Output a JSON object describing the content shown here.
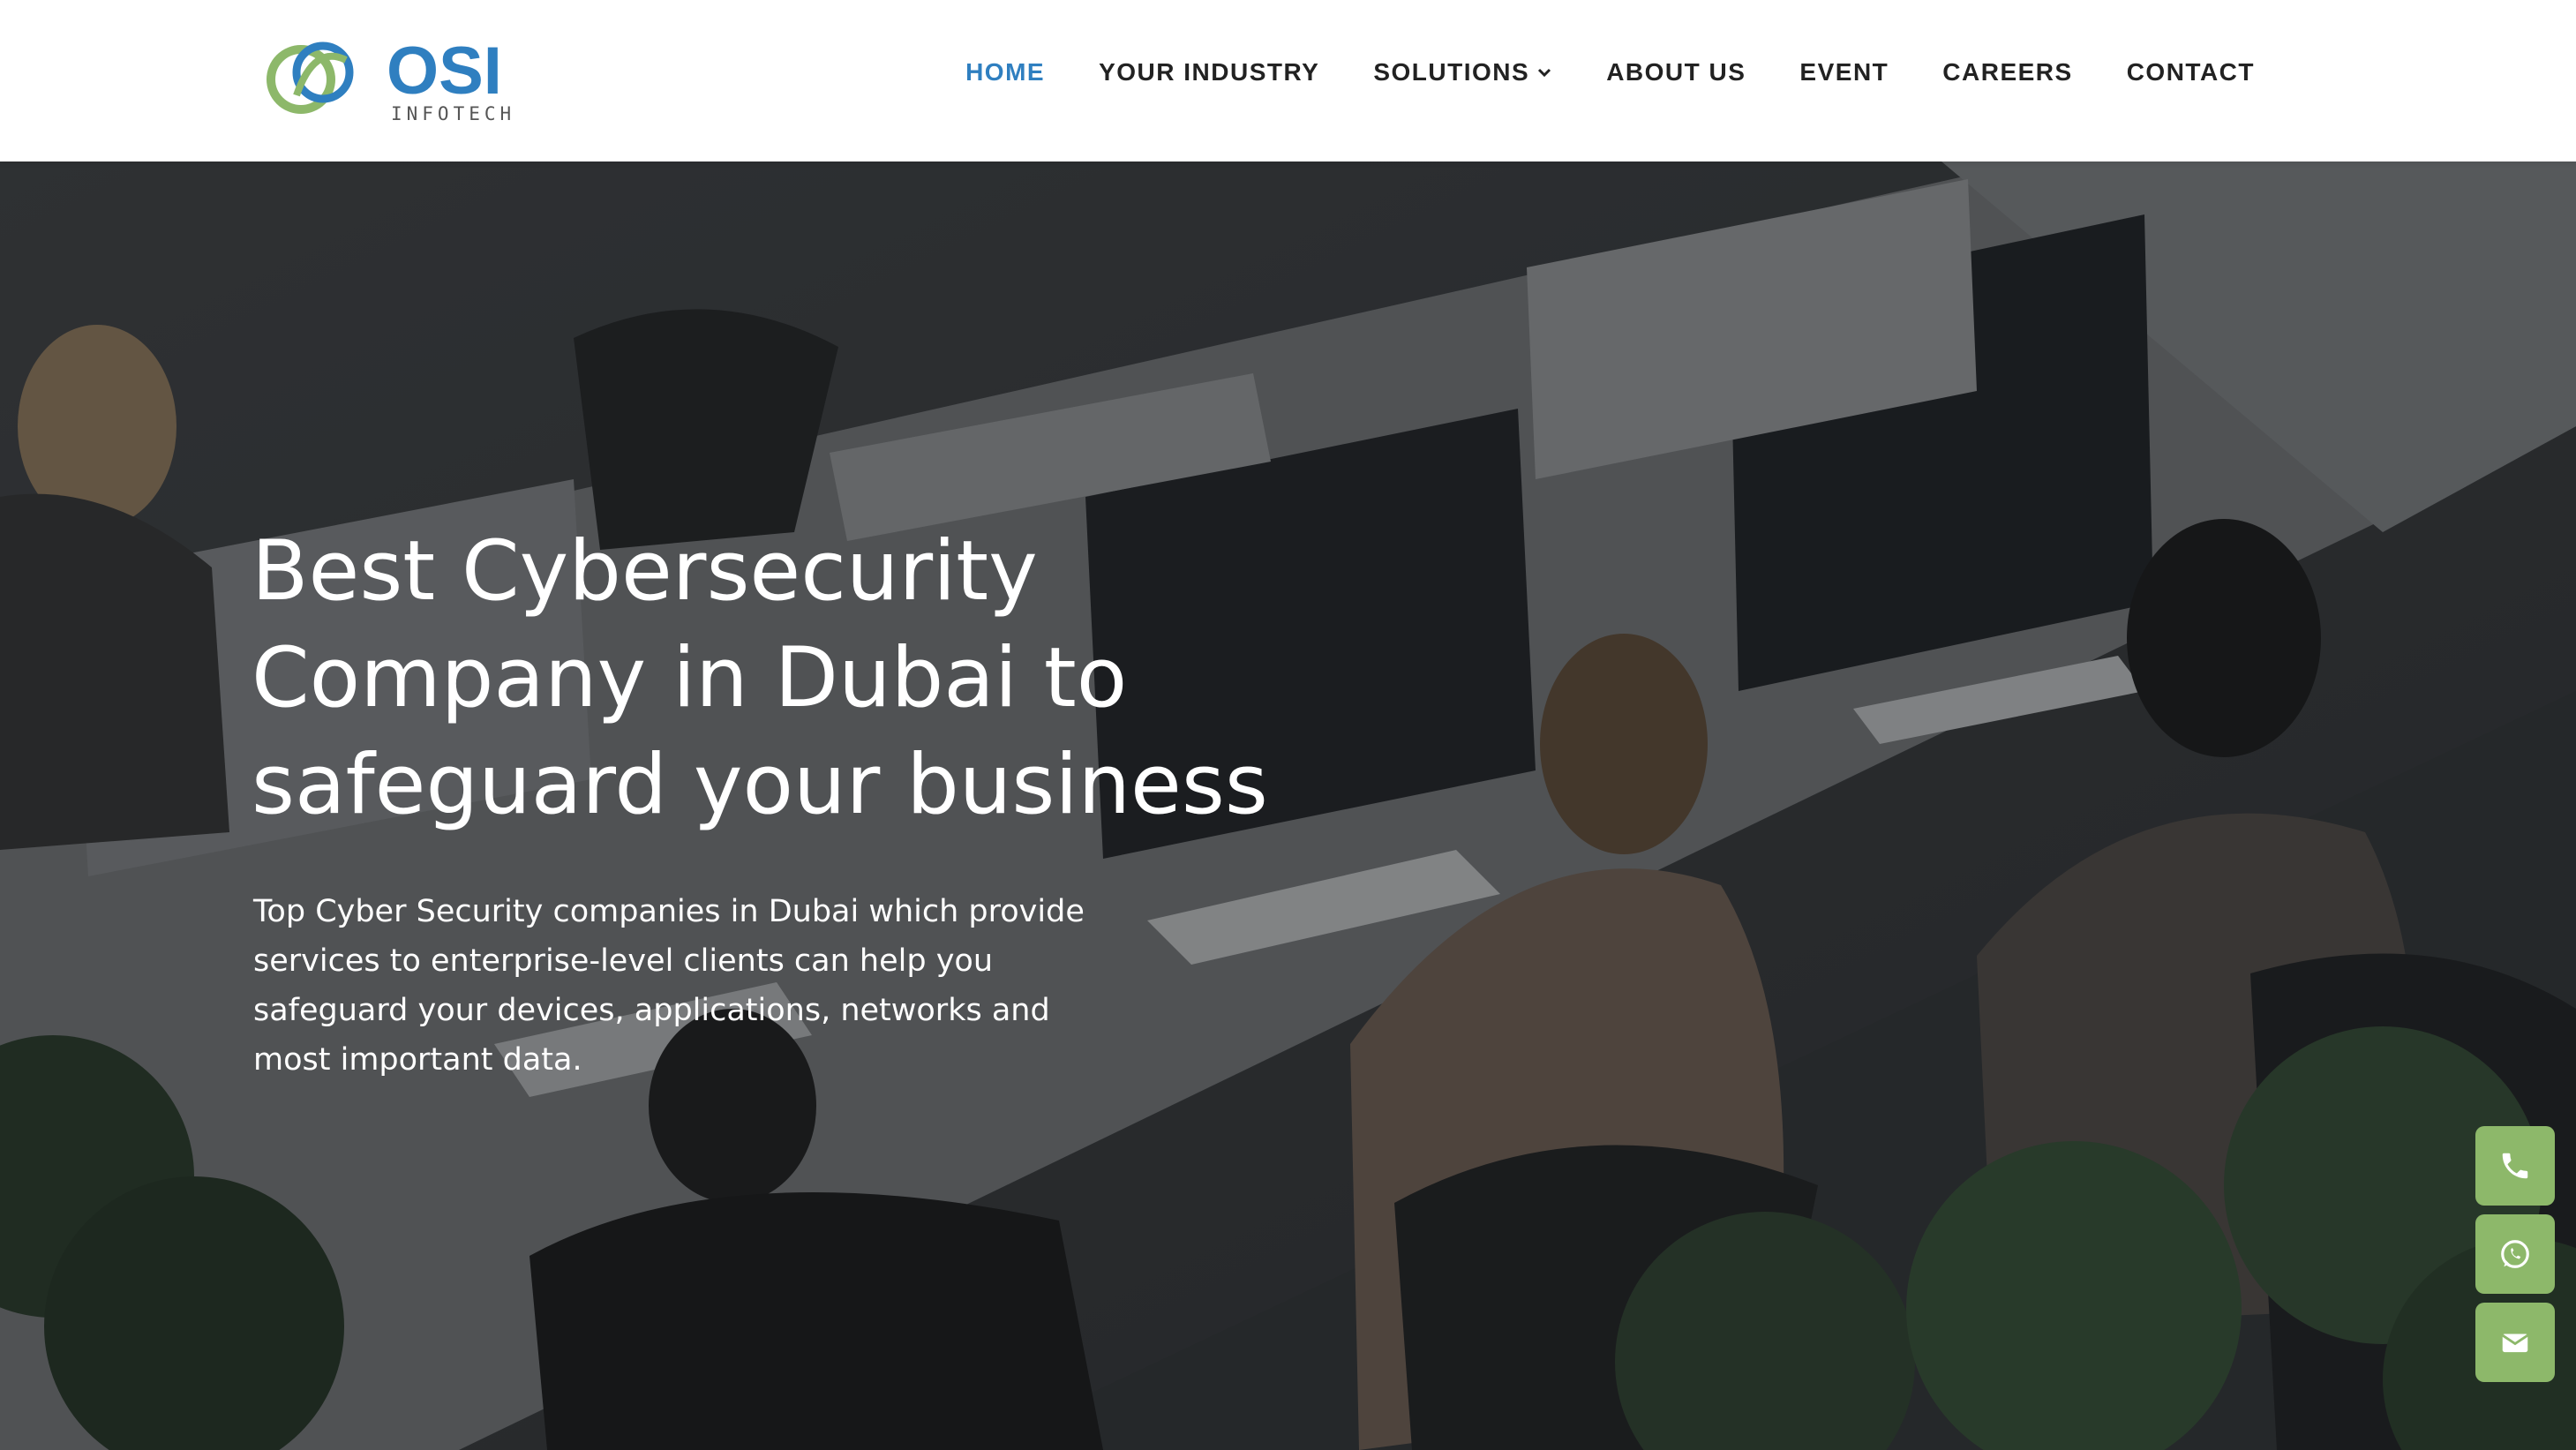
{
  "brand": {
    "logo_text": "OSI",
    "logo_subtext": "INFOTECH"
  },
  "nav": {
    "items": [
      {
        "label": "HOME",
        "active": true
      },
      {
        "label": "YOUR INDUSTRY",
        "active": false
      },
      {
        "label": "SOLUTIONS",
        "active": false,
        "dropdown": true
      },
      {
        "label": "ABOUT US",
        "active": false
      },
      {
        "label": "EVENT",
        "active": false
      },
      {
        "label": "CAREERS",
        "active": false
      },
      {
        "label": "CONTACT",
        "active": false
      }
    ]
  },
  "hero": {
    "headline_lines": [
      "Best Cybersecurity",
      "Company in Dubai to",
      "safeguard your business"
    ],
    "subtext_lines": [
      "Top Cyber Security companies in Dubai which provide",
      "services to enterprise-level clients can help you",
      "safeguard your devices, applications, networks and",
      "most important data."
    ]
  },
  "floating_actions": [
    {
      "icon": "phone-icon"
    },
    {
      "icon": "whatsapp-icon"
    },
    {
      "icon": "mail-icon"
    }
  ],
  "colors": {
    "accent_blue": "#2f7fc0",
    "accent_green": "#8db86a",
    "nav_text": "#222222"
  }
}
